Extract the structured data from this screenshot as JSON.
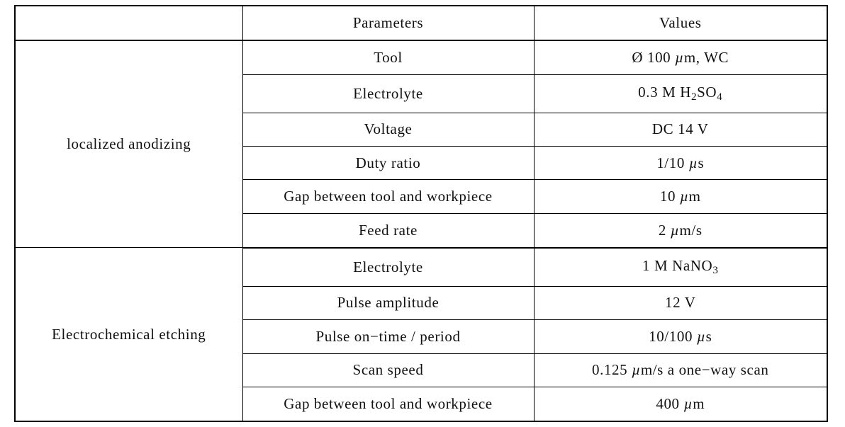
{
  "table": {
    "columns": [
      "",
      "Parameters",
      "Values"
    ],
    "header": {
      "blank": "",
      "parameters": "Parameters",
      "values": "Values"
    },
    "groups": [
      {
        "label": "localized anodizing",
        "rows": [
          {
            "parameter": "Tool",
            "value": "Ø 100 µm, WC",
            "value_html": "Ø 100 <span class=\"mu\">µ</span>m, WC"
          },
          {
            "parameter": "Electrolyte",
            "value": "0.3 M H2SO4",
            "value_html": "0.3 M H<span class=\"sub\">2</span>SO<span class=\"sub\">4</span>"
          },
          {
            "parameter": "Voltage",
            "value": "DC 14 V",
            "value_html": "DC 14 V"
          },
          {
            "parameter": "Duty ratio",
            "value": "1/10 µs",
            "value_html": "1/10 <span class=\"mu\">µ</span>s"
          },
          {
            "parameter": "Gap between tool and workpiece",
            "value": "10 µm",
            "value_html": "10 <span class=\"mu\">µ</span>m"
          },
          {
            "parameter": "Feed rate",
            "value": "2 µm/s",
            "value_html": "2 <span class=\"mu\">µ</span>m/s"
          }
        ]
      },
      {
        "label": "Electrochemical etching",
        "rows": [
          {
            "parameter": "Electrolyte",
            "value": "1 M NaNO3",
            "value_html": "1 M NaNO<span class=\"sub\">3</span>"
          },
          {
            "parameter": "Pulse amplitude",
            "value": "12 V",
            "value_html": "12 V"
          },
          {
            "parameter": "Pulse on−time / period",
            "value": "10/100 µs",
            "value_html": "10/100 <span class=\"mu\">µ</span>s"
          },
          {
            "parameter": "Scan speed",
            "value": "0.125 µm/s a one−way scan",
            "value_html": "0.125 <span class=\"mu\">µ</span>m/s a one−way scan"
          },
          {
            "parameter": "Gap between tool and workpiece",
            "value": "400 µm",
            "value_html": "400 <span class=\"mu\">µ</span>m"
          }
        ]
      }
    ]
  },
  "colors": {
    "border": "#000000",
    "text": "#111111",
    "background": "#ffffff"
  }
}
